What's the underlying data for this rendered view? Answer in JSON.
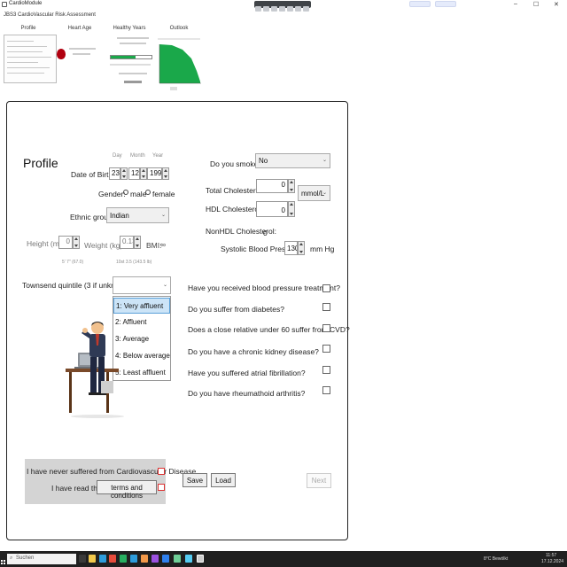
{
  "window": {
    "title": "CardioModule"
  },
  "app": {
    "subtitle": "JBS3 CardioVascular Risk Assessment"
  },
  "nav": {
    "tabs": [
      {
        "label": "Profile"
      },
      {
        "label": "Heart Age"
      },
      {
        "label": "Healthy Years"
      },
      {
        "label": "Outlook"
      }
    ]
  },
  "profile": {
    "title": "Profile",
    "dob": {
      "label": "Date of Birth",
      "day_header": "Day",
      "month_header": "Month",
      "year_header": "Year",
      "day": "23",
      "month": "12",
      "year": "1990"
    },
    "gender": {
      "label": "Gender:",
      "male": "male",
      "female": "female"
    },
    "ethnic": {
      "label": "Ethnic group",
      "value": "Indian"
    },
    "height": {
      "label": "Height (m):",
      "value": "0",
      "hint": "5' 7\" (67.0)"
    },
    "weight": {
      "label": "Weight (kg):",
      "value": "0.13",
      "hint": "10st 3.5 (143.5 lb)"
    },
    "bmi": {
      "label": "BMI:",
      "value": "∞"
    },
    "townsend": {
      "label": "Townsend quintile (3 if unknown):",
      "options": [
        "1: Very affluent",
        "2: Affluent",
        "3: Average",
        "4: Below average",
        "5: Least affluent"
      ],
      "selected_index": 0
    }
  },
  "risk": {
    "smoke": {
      "label": "Do you smoke?",
      "value": "No"
    },
    "total_chol": {
      "label": "Total Cholesterol:",
      "value": "0"
    },
    "units": {
      "value": "mmol/L"
    },
    "hdl": {
      "label": "HDL Cholesterol:",
      "value": "0"
    },
    "nonhdl": {
      "label": "NonHDL Cholesterol:",
      "value": "0"
    },
    "sbp": {
      "label": "Systolic Blood Pressure:",
      "value": "130",
      "unit": "mm Hg"
    }
  },
  "questions": [
    "Have you received blood pressure treatment?",
    "Do you suffer from diabetes?",
    "Does a close relative under 60 suffer from CVD?",
    "Do you have a chronic kidney disease?",
    "Have you suffered atrial fibrillation?",
    "Do you have rheumathoid arthritis?"
  ],
  "declarations": {
    "never_cvd": "I have never suffered from Cardiovascular Disease",
    "read_the": "I have read the",
    "terms_button": "terms and conditions"
  },
  "buttons": {
    "save": "Save",
    "load": "Load",
    "next": "Next"
  },
  "taskbar": {
    "search": "Suchen",
    "status": "8°C Bewölkt",
    "time": "11:57",
    "date": "17.12.2024"
  },
  "colors": {
    "outlook_green": "#1aa84a",
    "selection": "#cce4f7",
    "heart": "#b10010",
    "checkbox_alert": "#dd3333"
  }
}
